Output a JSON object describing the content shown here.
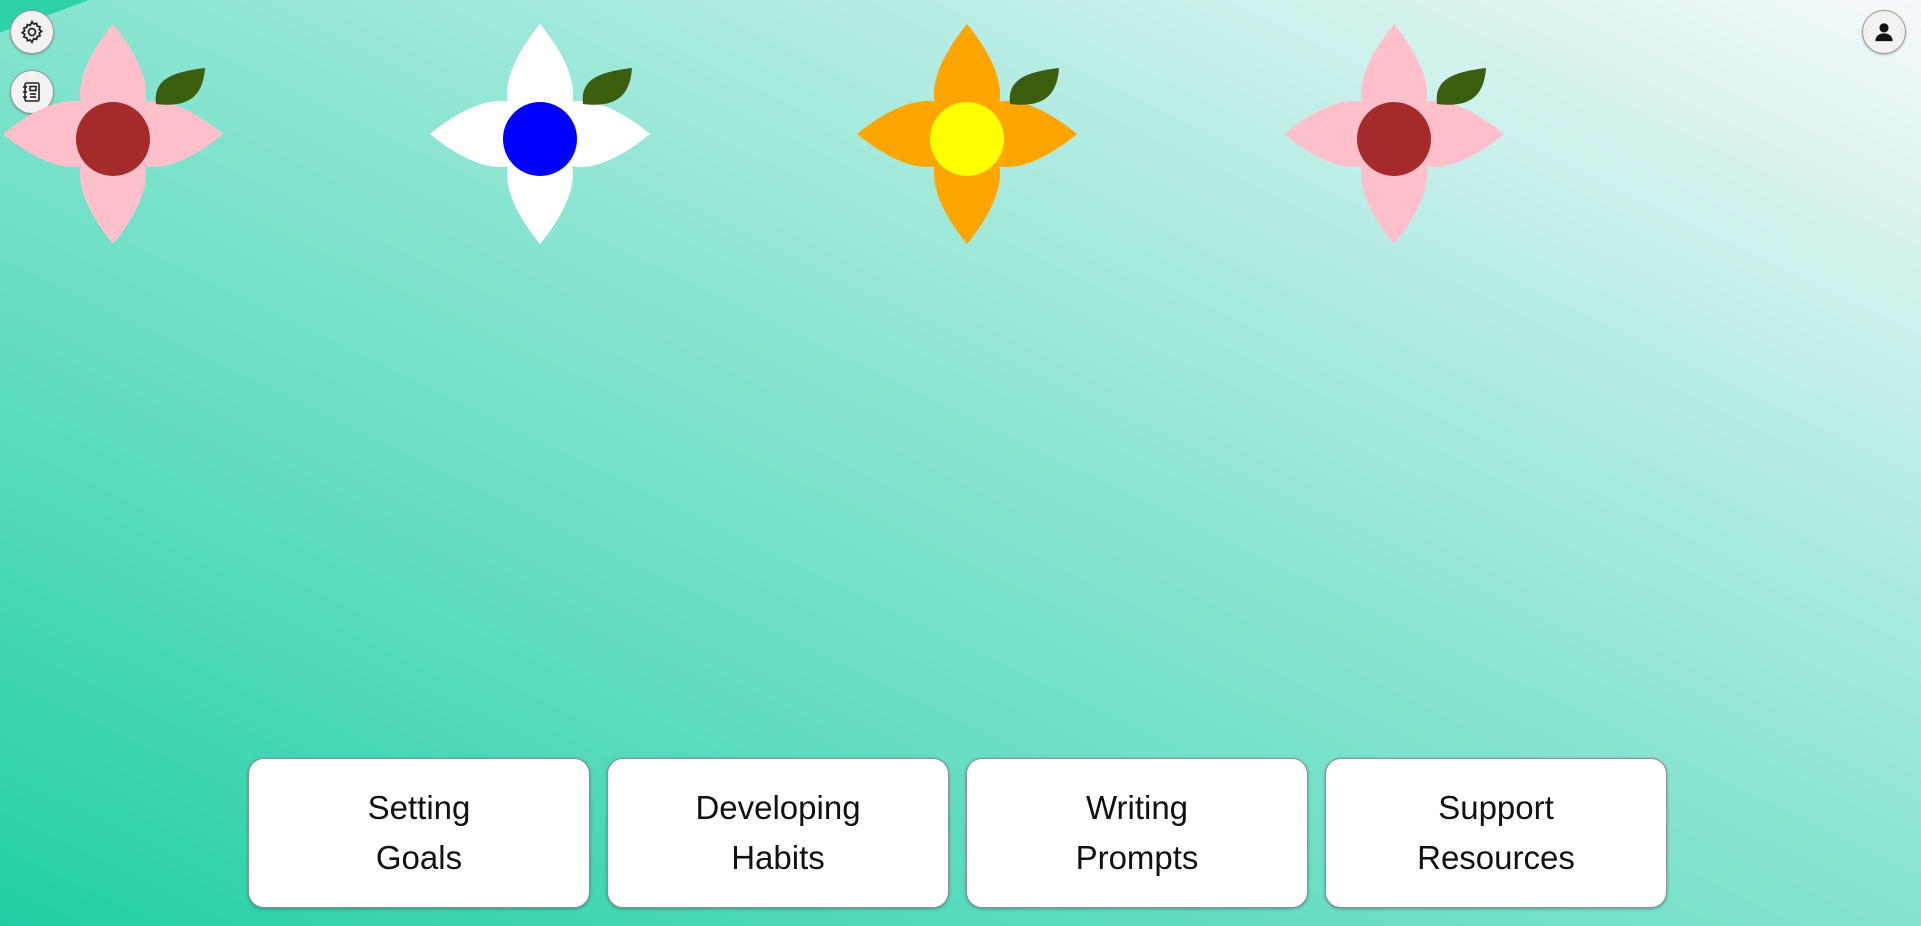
{
  "top_controls": {
    "settings_icon": "gear-icon",
    "journal_icon": "journal-icon",
    "profile_icon": "user-icon"
  },
  "flowers": [
    {
      "petal_color": "#FFC0CB",
      "center_color": "#A52A2A",
      "leaf_color": "#3B5E0E"
    },
    {
      "petal_color": "#FFFFFF",
      "center_color": "#0000FF",
      "leaf_color": "#3B5E0E"
    },
    {
      "petal_color": "#FFA500",
      "center_color": "#FFFF00",
      "leaf_color": "#3B5E0E"
    },
    {
      "petal_color": "#FFC0CB",
      "center_color": "#A52A2A",
      "leaf_color": "#3B5E0E"
    }
  ],
  "menu": [
    {
      "line1": "Setting",
      "line2": "Goals"
    },
    {
      "line1": "Developing",
      "line2": "Habits"
    },
    {
      "line1": "Writing",
      "line2": "Prompts"
    },
    {
      "line1": "Support",
      "line2": "Resources"
    }
  ]
}
